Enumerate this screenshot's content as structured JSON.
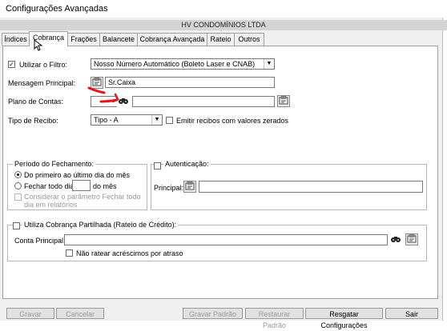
{
  "window": {
    "title": "Configurações Avançadas"
  },
  "company": "HV CONDOMÍNIOS LTDA",
  "tabs": [
    {
      "label": "Índices"
    },
    {
      "label": "Cobrança"
    },
    {
      "label": "Frações"
    },
    {
      "label": "Balancete"
    },
    {
      "label": "Cobrança Avançada"
    },
    {
      "label": "Rateio"
    },
    {
      "label": "Outros"
    }
  ],
  "form": {
    "filtro_label": "Utilizar o Filtro:",
    "filtro_checked": true,
    "filtro_value": "Nosso Número Automático (Boleto Laser e CNAB)",
    "mensagem_label": "Mensagem Principal:",
    "mensagem_value": "Sr.Caixa",
    "plano_label": "Plano de Contas:",
    "plano_code": "",
    "plano_desc": "",
    "tipo_label": "Tipo de Recibo:",
    "tipo_value": "Tipo - A",
    "emitir_label": "Emitir recibos com valores zerados"
  },
  "periodo": {
    "title": "Período do Fechamento:",
    "opt1": "Do primeiro ao último dia do mês",
    "opt2_prefix": "Fechar todo dia",
    "opt2_suffix": "do mês",
    "opt2_day": "",
    "consider": "Considerar o parâmetro Fechar todo dia em relatórios"
  },
  "autenticacao": {
    "title": "Autenticação:",
    "principal_label": "Principal:",
    "principal_value": ""
  },
  "partilhada": {
    "title": "Utiliza Cobrança Partilhada (Rateio de Crédito):",
    "conta_label": "Conta Principal:",
    "conta_value": "",
    "nao_ratear": "Não ratear acréscimos por atraso"
  },
  "buttons": {
    "gravar": "Gravar",
    "cancelar": "Cancelar",
    "gravar_padrao": "Gravar Padrão",
    "restaurar_padrao": "Restaurar Padrão",
    "resgatar": "Resgatar Configurações",
    "sair": "Sair"
  },
  "annotation_color": "#e8141b"
}
